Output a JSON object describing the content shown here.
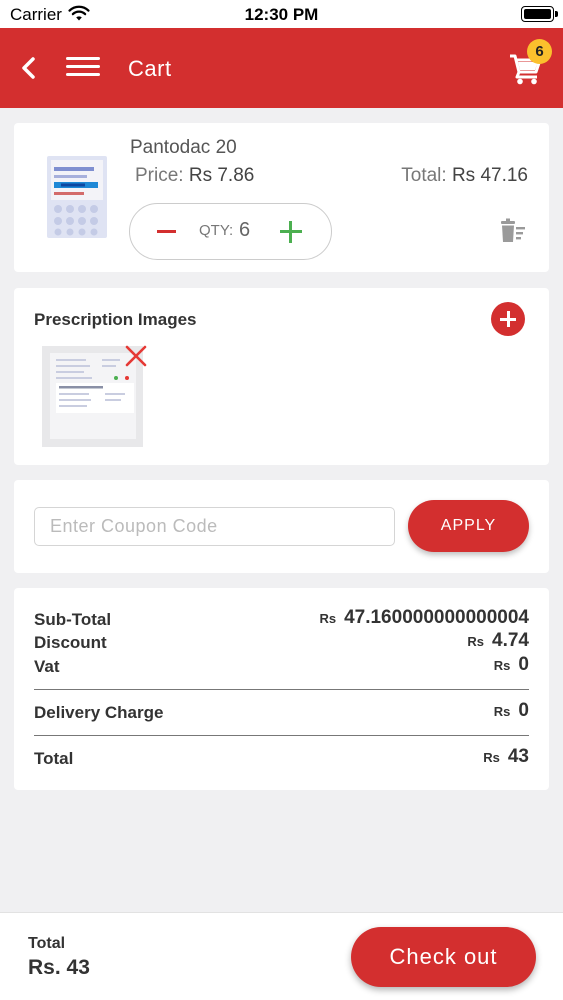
{
  "status_bar": {
    "carrier": "Carrier",
    "time": "12:30 PM"
  },
  "header": {
    "title": "Cart",
    "cart_count": "6",
    "accent_color": "#d32f2f",
    "badge_color": "#fbc02d"
  },
  "product": {
    "name": "Pantodac 20",
    "price_label": "Price:",
    "price_value": "Rs 7.86",
    "total_label": "Total:",
    "total_value": "Rs 47.16",
    "qty_label": "QTY:",
    "qty_value": "6"
  },
  "prescription": {
    "title": "Prescription Images"
  },
  "coupon": {
    "placeholder": "Enter Coupon Code",
    "value": "",
    "apply_label": "APPLY"
  },
  "summary": {
    "currency": "Rs",
    "subtotal_label": "Sub-Total",
    "subtotal_value": "47.160000000000004",
    "discount_label": "Discount",
    "discount_value": "4.74",
    "vat_label": "Vat",
    "vat_value": "0",
    "delivery_label": "Delivery Charge",
    "delivery_value": "0",
    "total_label": "Total",
    "total_value": "43"
  },
  "bottom": {
    "total_label": "Total",
    "total_value": "Rs. 43",
    "checkout_label": "Check out"
  },
  "icons": [
    "wifi-icon",
    "battery-icon",
    "back-arrow-icon",
    "hamburger-menu-icon",
    "cart-icon",
    "minus-icon",
    "plus-icon",
    "trash-icon",
    "add-circle-icon",
    "close-x-icon"
  ]
}
